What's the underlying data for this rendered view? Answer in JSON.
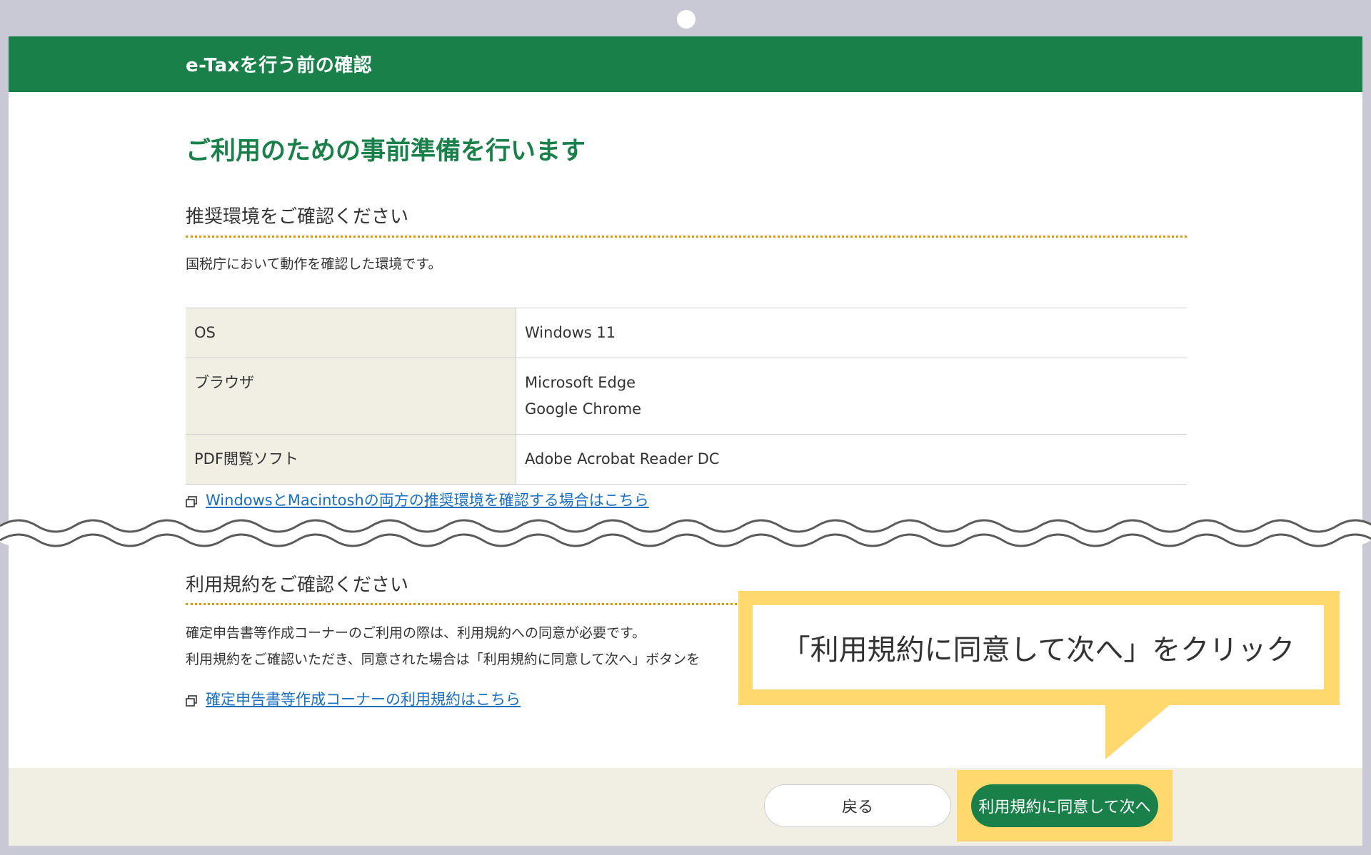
{
  "header": {
    "title": "e-Taxを行う前の確認"
  },
  "page_title": "ご利用のための事前準備を行います",
  "env_section": {
    "title": "推奨環境をご確認ください",
    "description": "国税庁において動作を確認した環境です。",
    "table": [
      {
        "label": "OS",
        "values": [
          "Windows 11"
        ]
      },
      {
        "label": "ブラウザ",
        "values": [
          "Microsoft Edge",
          "Google Chrome"
        ]
      },
      {
        "label": "PDF閲覧ソフト",
        "values": [
          "Adobe Acrobat Reader DC"
        ]
      }
    ],
    "link": "WindowsとMacintoshの両方の推奨環境を確認する場合はこちら"
  },
  "terms_section": {
    "title": "利用規約をご確認ください",
    "line1": "確定申告書等作成コーナーのご利用の際は、利用規約への同意が必要です。",
    "line2": "利用規約をご確認いただき、同意された場合は「利用規約に同意して次へ」ボタンを",
    "link": "確定申告書等作成コーナーの利用規約はこちら"
  },
  "footer": {
    "back_label": "戻る",
    "next_label": "利用規約に同意して次へ"
  },
  "callout": {
    "text": "「利用規約に同意して次へ」をクリック"
  },
  "colors": {
    "brand_green": "#1a804a",
    "highlight_yellow": "#ffd86e",
    "link_blue": "#1b6fc0",
    "dotted_orange": "#e3960c",
    "table_header_bg": "#f1efe4"
  }
}
